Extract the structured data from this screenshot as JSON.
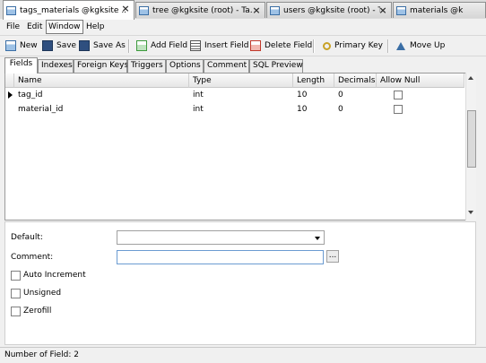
{
  "doc_tabs": [
    {
      "label": "tags_materials @kgksite ...",
      "active": true
    },
    {
      "label": "tree @kgksite (root) - Ta...",
      "active": false
    },
    {
      "label": "users @kgksite (root) - T...",
      "active": false
    },
    {
      "label": "materials @k",
      "active": false
    }
  ],
  "tab_close_glyph": "×",
  "menu": [
    "File",
    "Edit",
    "Window",
    "Help"
  ],
  "toolbar": {
    "new": "New",
    "save": "Save",
    "save_as": "Save As",
    "add_field": "Add Field",
    "insert_field": "Insert Field",
    "delete_field": "Delete Field",
    "primary_key": "Primary Key",
    "move_up": "Move Up"
  },
  "prop_tabs": [
    "Fields",
    "Indexes",
    "Foreign Keys",
    "Triggers",
    "Options",
    "Comment",
    "SQL Preview"
  ],
  "grid": {
    "columns": [
      "Name",
      "Type",
      "Length",
      "Decimals",
      "Allow Null"
    ],
    "rows": [
      {
        "name": "tag_id",
        "type": "int",
        "length": "10",
        "decimals": "0",
        "allow_null": false,
        "current": true
      },
      {
        "name": "material_id",
        "type": "int",
        "length": "10",
        "decimals": "0",
        "allow_null": false,
        "current": false
      }
    ]
  },
  "form": {
    "default_label": "Default:",
    "default_value": "",
    "comment_label": "Comment:",
    "comment_value": "",
    "ellipsis": "...",
    "auto_increment": "Auto Increment",
    "unsigned": "Unsigned",
    "zerofill": "Zerofill"
  },
  "status": "Number of Field: 2",
  "colors": {
    "icon_blue": "#3a6ea5",
    "icon_green": "#3c9a3c",
    "icon_red": "#c0392b",
    "icon_gold": "#c9a227"
  }
}
